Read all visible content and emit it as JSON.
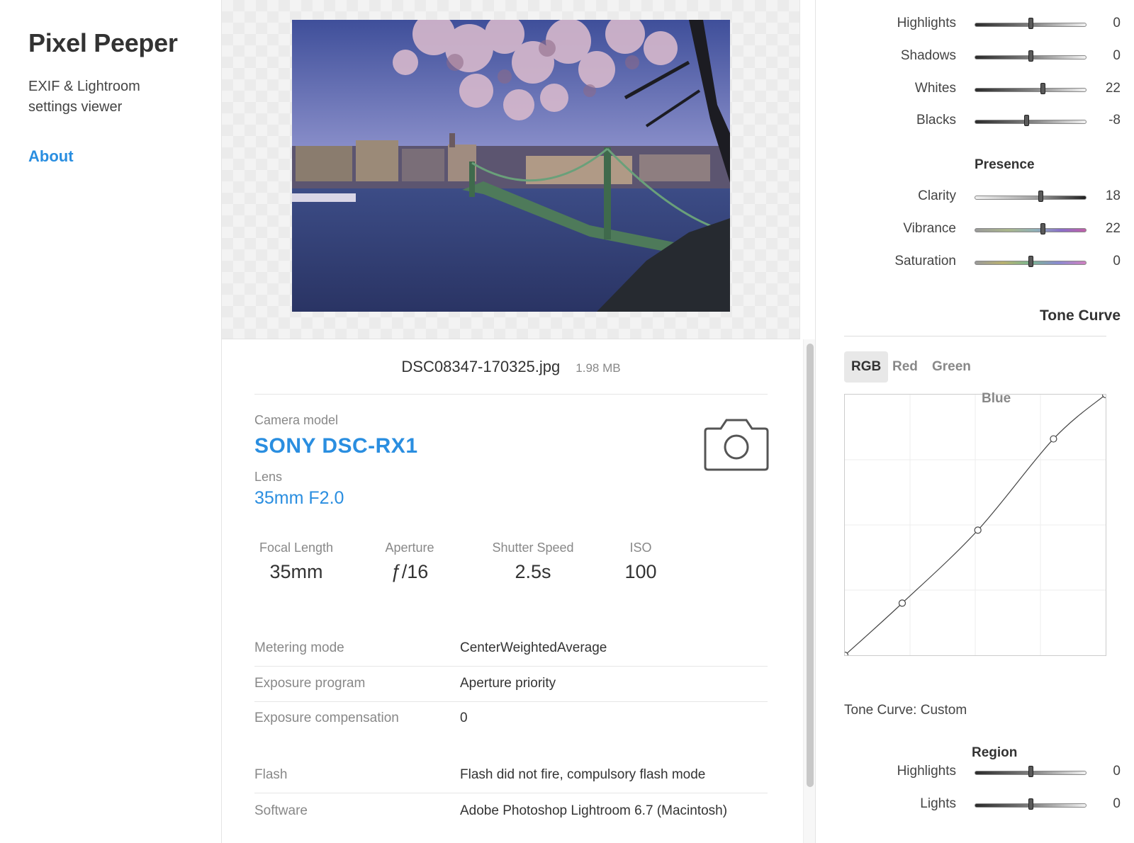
{
  "sidebar": {
    "title": "Pixel Peeper",
    "subtitle": "EXIF & Lightroom settings viewer",
    "about": "About"
  },
  "photo": {
    "alt_icon": "photo-image"
  },
  "file": {
    "name": "DSC08347-170325.jpg",
    "size": "1.98 MB"
  },
  "camera": {
    "model_label": "Camera model",
    "model": "SONY DSC-RX1",
    "lens_label": "Lens",
    "lens": "35mm F2.0",
    "icon": "camera-icon"
  },
  "stats": [
    {
      "label": "Focal Length",
      "value": "35mm"
    },
    {
      "label": "Aperture",
      "value": "ƒ/16"
    },
    {
      "label": "Shutter Speed",
      "value": "2.5s"
    },
    {
      "label": "ISO",
      "value": "100"
    }
  ],
  "meta": [
    {
      "label": "Metering mode",
      "value": "CenterWeightedAverage"
    },
    {
      "label": "Exposure program",
      "value": "Aperture priority"
    },
    {
      "label": "Exposure compensation",
      "value": "0"
    },
    {
      "label": "Flash",
      "value": "Flash did not fire, compulsory flash mode"
    },
    {
      "label": "Software",
      "value": "Adobe Photoshop Lightroom 6.7 (Macintosh)"
    }
  ],
  "basic_tone": [
    {
      "label": "Highlights",
      "value": "0",
      "min": -100,
      "max": 100
    },
    {
      "label": "Shadows",
      "value": "0",
      "min": -100,
      "max": 100
    },
    {
      "label": "Whites",
      "value": "22",
      "min": -100,
      "max": 100
    },
    {
      "label": "Blacks",
      "value": "-8",
      "min": -100,
      "max": 100
    }
  ],
  "presence": {
    "heading": "Presence",
    "sliders": [
      {
        "label": "Clarity",
        "value": "18",
        "min": -100,
        "max": 100
      },
      {
        "label": "Vibrance",
        "value": "22",
        "min": -100,
        "max": 100
      },
      {
        "label": "Saturation",
        "value": "0",
        "min": -100,
        "max": 100
      }
    ]
  },
  "tone_curve": {
    "heading": "Tone Curve",
    "tabs": [
      "RGB",
      "Red",
      "Green",
      "Blue"
    ],
    "active_tab": "RGB",
    "points": [
      [
        0,
        0
      ],
      [
        0.22,
        0.2
      ],
      [
        0.51,
        0.48
      ],
      [
        0.8,
        0.83
      ],
      [
        1,
        1
      ]
    ],
    "caption": "Tone Curve: Custom"
  },
  "region": {
    "heading": "Region",
    "sliders": [
      {
        "label": "Highlights",
        "value": "0",
        "min": -100,
        "max": 100
      },
      {
        "label": "Lights",
        "value": "0",
        "min": -100,
        "max": 100
      }
    ]
  },
  "colors": {
    "accent": "#2a8ee0",
    "text": "#333333",
    "muted": "#888888"
  }
}
